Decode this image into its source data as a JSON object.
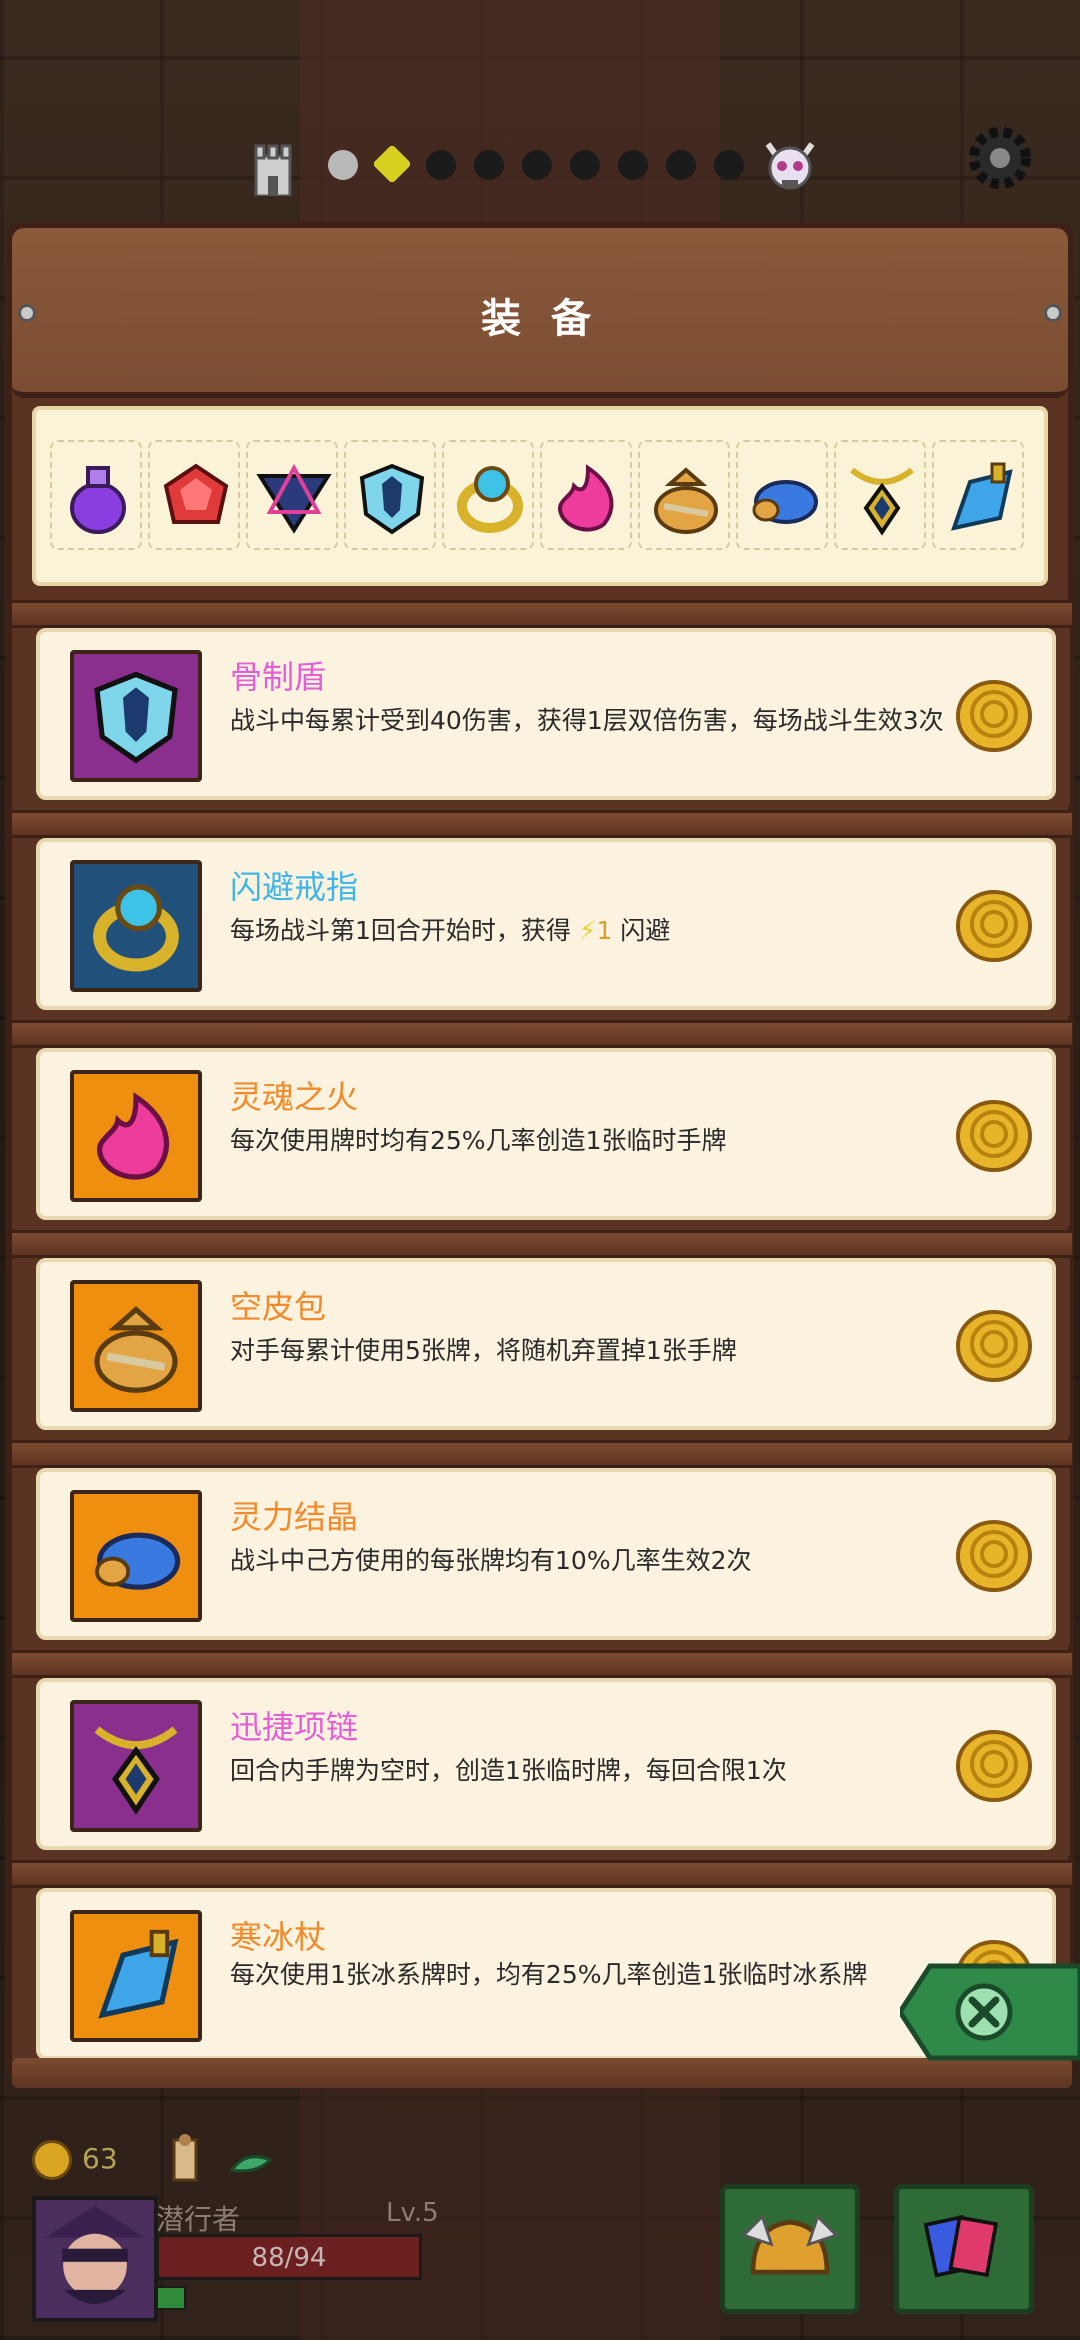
{
  "panel": {
    "title": "装 备"
  },
  "strip_icons": [
    "potion-icon",
    "ruby-icon",
    "rune-icon",
    "bone-shield-icon",
    "ring-icon",
    "soul-fire-icon",
    "leather-bag-icon",
    "crystal-icon",
    "necklace-icon",
    "ice-staff-icon"
  ],
  "items": [
    {
      "name": "骨制盾",
      "desc": "战斗中每累计受到40伤害，获得1层双倍伤害，每场战斗生效3次",
      "rarity_color": "#e45ed6",
      "frame_color": "#8b2f8f",
      "icon": "bone-shield-icon"
    },
    {
      "name": "闪避戒指",
      "desc_prefix": "每场战斗第1回合开始时，获得",
      "desc_value": "1",
      "desc_suffix": "闪避",
      "rarity_color": "#3fb6e8",
      "frame_color": "#21507a",
      "icon": "ring-icon"
    },
    {
      "name": "灵魂之火",
      "desc": "每次使用牌时均有25%几率创造1张临时手牌",
      "rarity_color": "#f08a2a",
      "frame_color": "#ef8f0f",
      "icon": "soul-fire-icon"
    },
    {
      "name": "空皮包",
      "desc": "对手每累计使用5张牌，将随机弃置掉1张手牌",
      "rarity_color": "#f08a2a",
      "frame_color": "#ef8f0f",
      "icon": "leather-bag-icon"
    },
    {
      "name": "灵力结晶",
      "desc": "战斗中己方使用的每张牌均有10%几率生效2次",
      "rarity_color": "#f08a2a",
      "frame_color": "#ef8f0f",
      "icon": "crystal-icon"
    },
    {
      "name": "迅捷项链",
      "desc": "回合内手牌为空时，创造1张临时牌，每回合限1次",
      "rarity_color": "#e45ed6",
      "frame_color": "#8b2f8f",
      "icon": "necklace-icon"
    },
    {
      "name": "寒冰杖",
      "desc": "每次使用1张冰系牌时，均有25%几率创造1张临时冰系牌",
      "rarity_color": "#f08a2a",
      "frame_color": "#ef8f0f",
      "icon": "ice-staff-icon"
    }
  ],
  "hud": {
    "gold": "63",
    "character_name": "潜行者",
    "level": "Lv.5",
    "hp": "88/94"
  }
}
